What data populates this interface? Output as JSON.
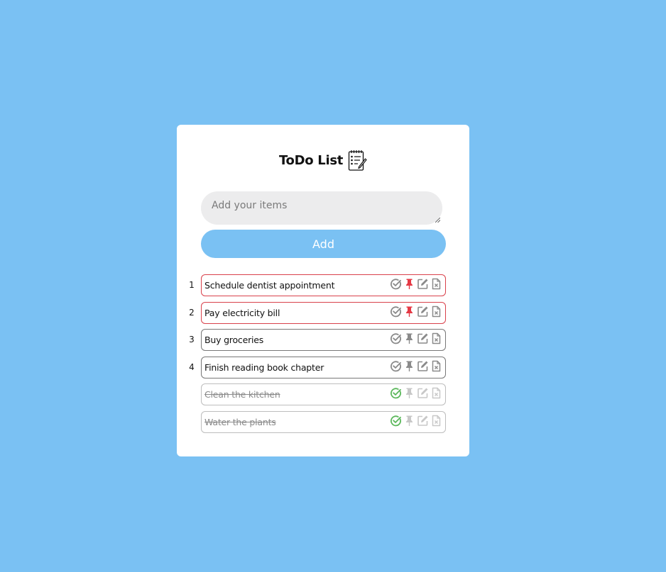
{
  "header": {
    "title": "ToDo List",
    "icon": "notepad-checklist-icon"
  },
  "composer": {
    "placeholder": "Add your items",
    "value": "",
    "add_label": "Add"
  },
  "colors": {
    "background": "#7ac1f3",
    "card": "#ffffff",
    "add_button": "#7ac1f3",
    "pinned_accent": "#e53945",
    "done_check": "#5cb85c",
    "icon_gray": "#8a8a8a",
    "icon_disabled": "#c8c8c8"
  },
  "items": [
    {
      "number": "1",
      "text": "Schedule dentist appointment",
      "pinned": true,
      "done": false
    },
    {
      "number": "2",
      "text": "Pay electricity bill",
      "pinned": true,
      "done": false
    },
    {
      "number": "3",
      "text": "Buy groceries",
      "pinned": false,
      "done": false
    },
    {
      "number": "4",
      "text": "Finish reading book chapter",
      "pinned": false,
      "done": false
    },
    {
      "number": "",
      "text": "Clean the kitchen",
      "pinned": false,
      "done": true
    },
    {
      "number": "",
      "text": "Water the plants",
      "pinned": false,
      "done": true
    }
  ],
  "item_actions": [
    "check-circle-icon",
    "pin-icon",
    "edit-icon",
    "delete-file-icon"
  ]
}
